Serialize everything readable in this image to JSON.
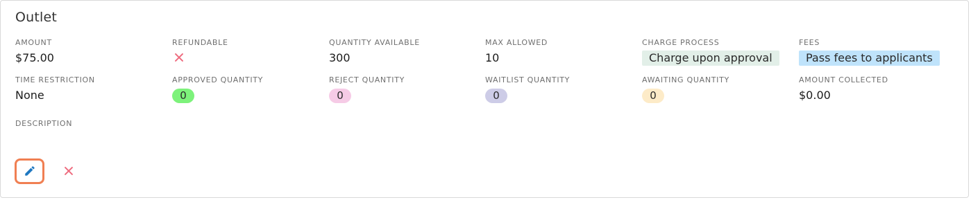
{
  "title": "Outlet",
  "fields": {
    "amount": {
      "label": "AMOUNT",
      "value": "$75.00"
    },
    "refundable": {
      "label": "REFUNDABLE",
      "icon": "close-icon",
      "color": "#ee6b7e"
    },
    "quantity_available": {
      "label": "QUANTITY AVAILABLE",
      "value": "300"
    },
    "max_allowed": {
      "label": "MAX ALLOWED",
      "value": "10"
    },
    "charge_process": {
      "label": "CHARGE PROCESS",
      "value": "Charge upon approval",
      "color": "#e2efe8"
    },
    "fees": {
      "label": "FEES",
      "value": "Pass fees to applicants",
      "color": "#bfe3fb"
    },
    "time_restriction": {
      "label": "TIME RESTRICTION",
      "value": "None"
    },
    "approved_quantity": {
      "label": "APPROVED QUANTITY",
      "value": "0",
      "color": "#7df27b"
    },
    "reject_quantity": {
      "label": "REJECT QUANTITY",
      "value": "0",
      "color": "#f6cbe6"
    },
    "waitlist_quantity": {
      "label": "WAITLIST QUANTITY",
      "value": "0",
      "color": "#cdcce7"
    },
    "awaiting_quantity": {
      "label": "AWAITING QUANTITY",
      "value": "0",
      "color": "#fdebc8"
    },
    "amount_collected": {
      "label": "AMOUNT COLLECTED",
      "value": "$0.00"
    },
    "description": {
      "label": "DESCRIPTION",
      "value": ""
    }
  },
  "actions": {
    "edit": {
      "icon": "pencil-icon",
      "color": "#1f78c1",
      "border_color": "#f07f52"
    },
    "delete": {
      "icon": "close-icon",
      "color": "#ee6b7e"
    }
  }
}
